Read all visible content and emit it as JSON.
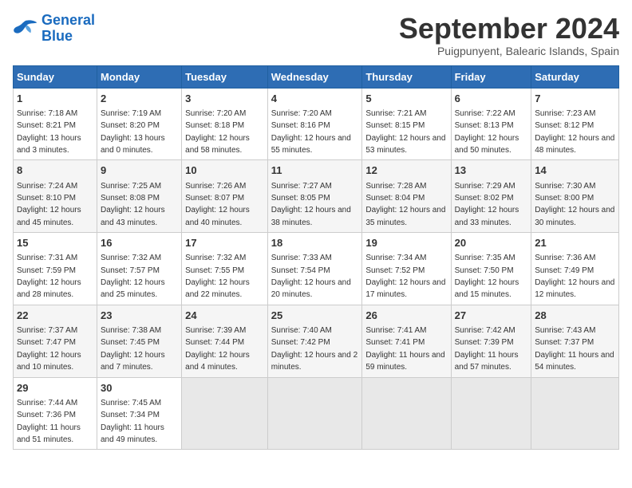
{
  "logo": {
    "line1": "General",
    "line2": "Blue"
  },
  "title": "September 2024",
  "subtitle": "Puigpunyent, Balearic Islands, Spain",
  "headers": [
    "Sunday",
    "Monday",
    "Tuesday",
    "Wednesday",
    "Thursday",
    "Friday",
    "Saturday"
  ],
  "weeks": [
    [
      {
        "day": "1",
        "rise": "7:18 AM",
        "set": "8:21 PM",
        "daylight": "13 hours and 3 minutes."
      },
      {
        "day": "2",
        "rise": "7:19 AM",
        "set": "8:20 PM",
        "daylight": "13 hours and 0 minutes."
      },
      {
        "day": "3",
        "rise": "7:20 AM",
        "set": "8:18 PM",
        "daylight": "12 hours and 58 minutes."
      },
      {
        "day": "4",
        "rise": "7:20 AM",
        "set": "8:16 PM",
        "daylight": "12 hours and 55 minutes."
      },
      {
        "day": "5",
        "rise": "7:21 AM",
        "set": "8:15 PM",
        "daylight": "12 hours and 53 minutes."
      },
      {
        "day": "6",
        "rise": "7:22 AM",
        "set": "8:13 PM",
        "daylight": "12 hours and 50 minutes."
      },
      {
        "day": "7",
        "rise": "7:23 AM",
        "set": "8:12 PM",
        "daylight": "12 hours and 48 minutes."
      }
    ],
    [
      {
        "day": "8",
        "rise": "7:24 AM",
        "set": "8:10 PM",
        "daylight": "12 hours and 45 minutes."
      },
      {
        "day": "9",
        "rise": "7:25 AM",
        "set": "8:08 PM",
        "daylight": "12 hours and 43 minutes."
      },
      {
        "day": "10",
        "rise": "7:26 AM",
        "set": "8:07 PM",
        "daylight": "12 hours and 40 minutes."
      },
      {
        "day": "11",
        "rise": "7:27 AM",
        "set": "8:05 PM",
        "daylight": "12 hours and 38 minutes."
      },
      {
        "day": "12",
        "rise": "7:28 AM",
        "set": "8:04 PM",
        "daylight": "12 hours and 35 minutes."
      },
      {
        "day": "13",
        "rise": "7:29 AM",
        "set": "8:02 PM",
        "daylight": "12 hours and 33 minutes."
      },
      {
        "day": "14",
        "rise": "7:30 AM",
        "set": "8:00 PM",
        "daylight": "12 hours and 30 minutes."
      }
    ],
    [
      {
        "day": "15",
        "rise": "7:31 AM",
        "set": "7:59 PM",
        "daylight": "12 hours and 28 minutes."
      },
      {
        "day": "16",
        "rise": "7:32 AM",
        "set": "7:57 PM",
        "daylight": "12 hours and 25 minutes."
      },
      {
        "day": "17",
        "rise": "7:32 AM",
        "set": "7:55 PM",
        "daylight": "12 hours and 22 minutes."
      },
      {
        "day": "18",
        "rise": "7:33 AM",
        "set": "7:54 PM",
        "daylight": "12 hours and 20 minutes."
      },
      {
        "day": "19",
        "rise": "7:34 AM",
        "set": "7:52 PM",
        "daylight": "12 hours and 17 minutes."
      },
      {
        "day": "20",
        "rise": "7:35 AM",
        "set": "7:50 PM",
        "daylight": "12 hours and 15 minutes."
      },
      {
        "day": "21",
        "rise": "7:36 AM",
        "set": "7:49 PM",
        "daylight": "12 hours and 12 minutes."
      }
    ],
    [
      {
        "day": "22",
        "rise": "7:37 AM",
        "set": "7:47 PM",
        "daylight": "12 hours and 10 minutes."
      },
      {
        "day": "23",
        "rise": "7:38 AM",
        "set": "7:45 PM",
        "daylight": "12 hours and 7 minutes."
      },
      {
        "day": "24",
        "rise": "7:39 AM",
        "set": "7:44 PM",
        "daylight": "12 hours and 4 minutes."
      },
      {
        "day": "25",
        "rise": "7:40 AM",
        "set": "7:42 PM",
        "daylight": "12 hours and 2 minutes."
      },
      {
        "day": "26",
        "rise": "7:41 AM",
        "set": "7:41 PM",
        "daylight": "11 hours and 59 minutes."
      },
      {
        "day": "27",
        "rise": "7:42 AM",
        "set": "7:39 PM",
        "daylight": "11 hours and 57 minutes."
      },
      {
        "day": "28",
        "rise": "7:43 AM",
        "set": "7:37 PM",
        "daylight": "11 hours and 54 minutes."
      }
    ],
    [
      {
        "day": "29",
        "rise": "7:44 AM",
        "set": "7:36 PM",
        "daylight": "11 hours and 51 minutes."
      },
      {
        "day": "30",
        "rise": "7:45 AM",
        "set": "7:34 PM",
        "daylight": "11 hours and 49 minutes."
      },
      null,
      null,
      null,
      null,
      null
    ]
  ]
}
